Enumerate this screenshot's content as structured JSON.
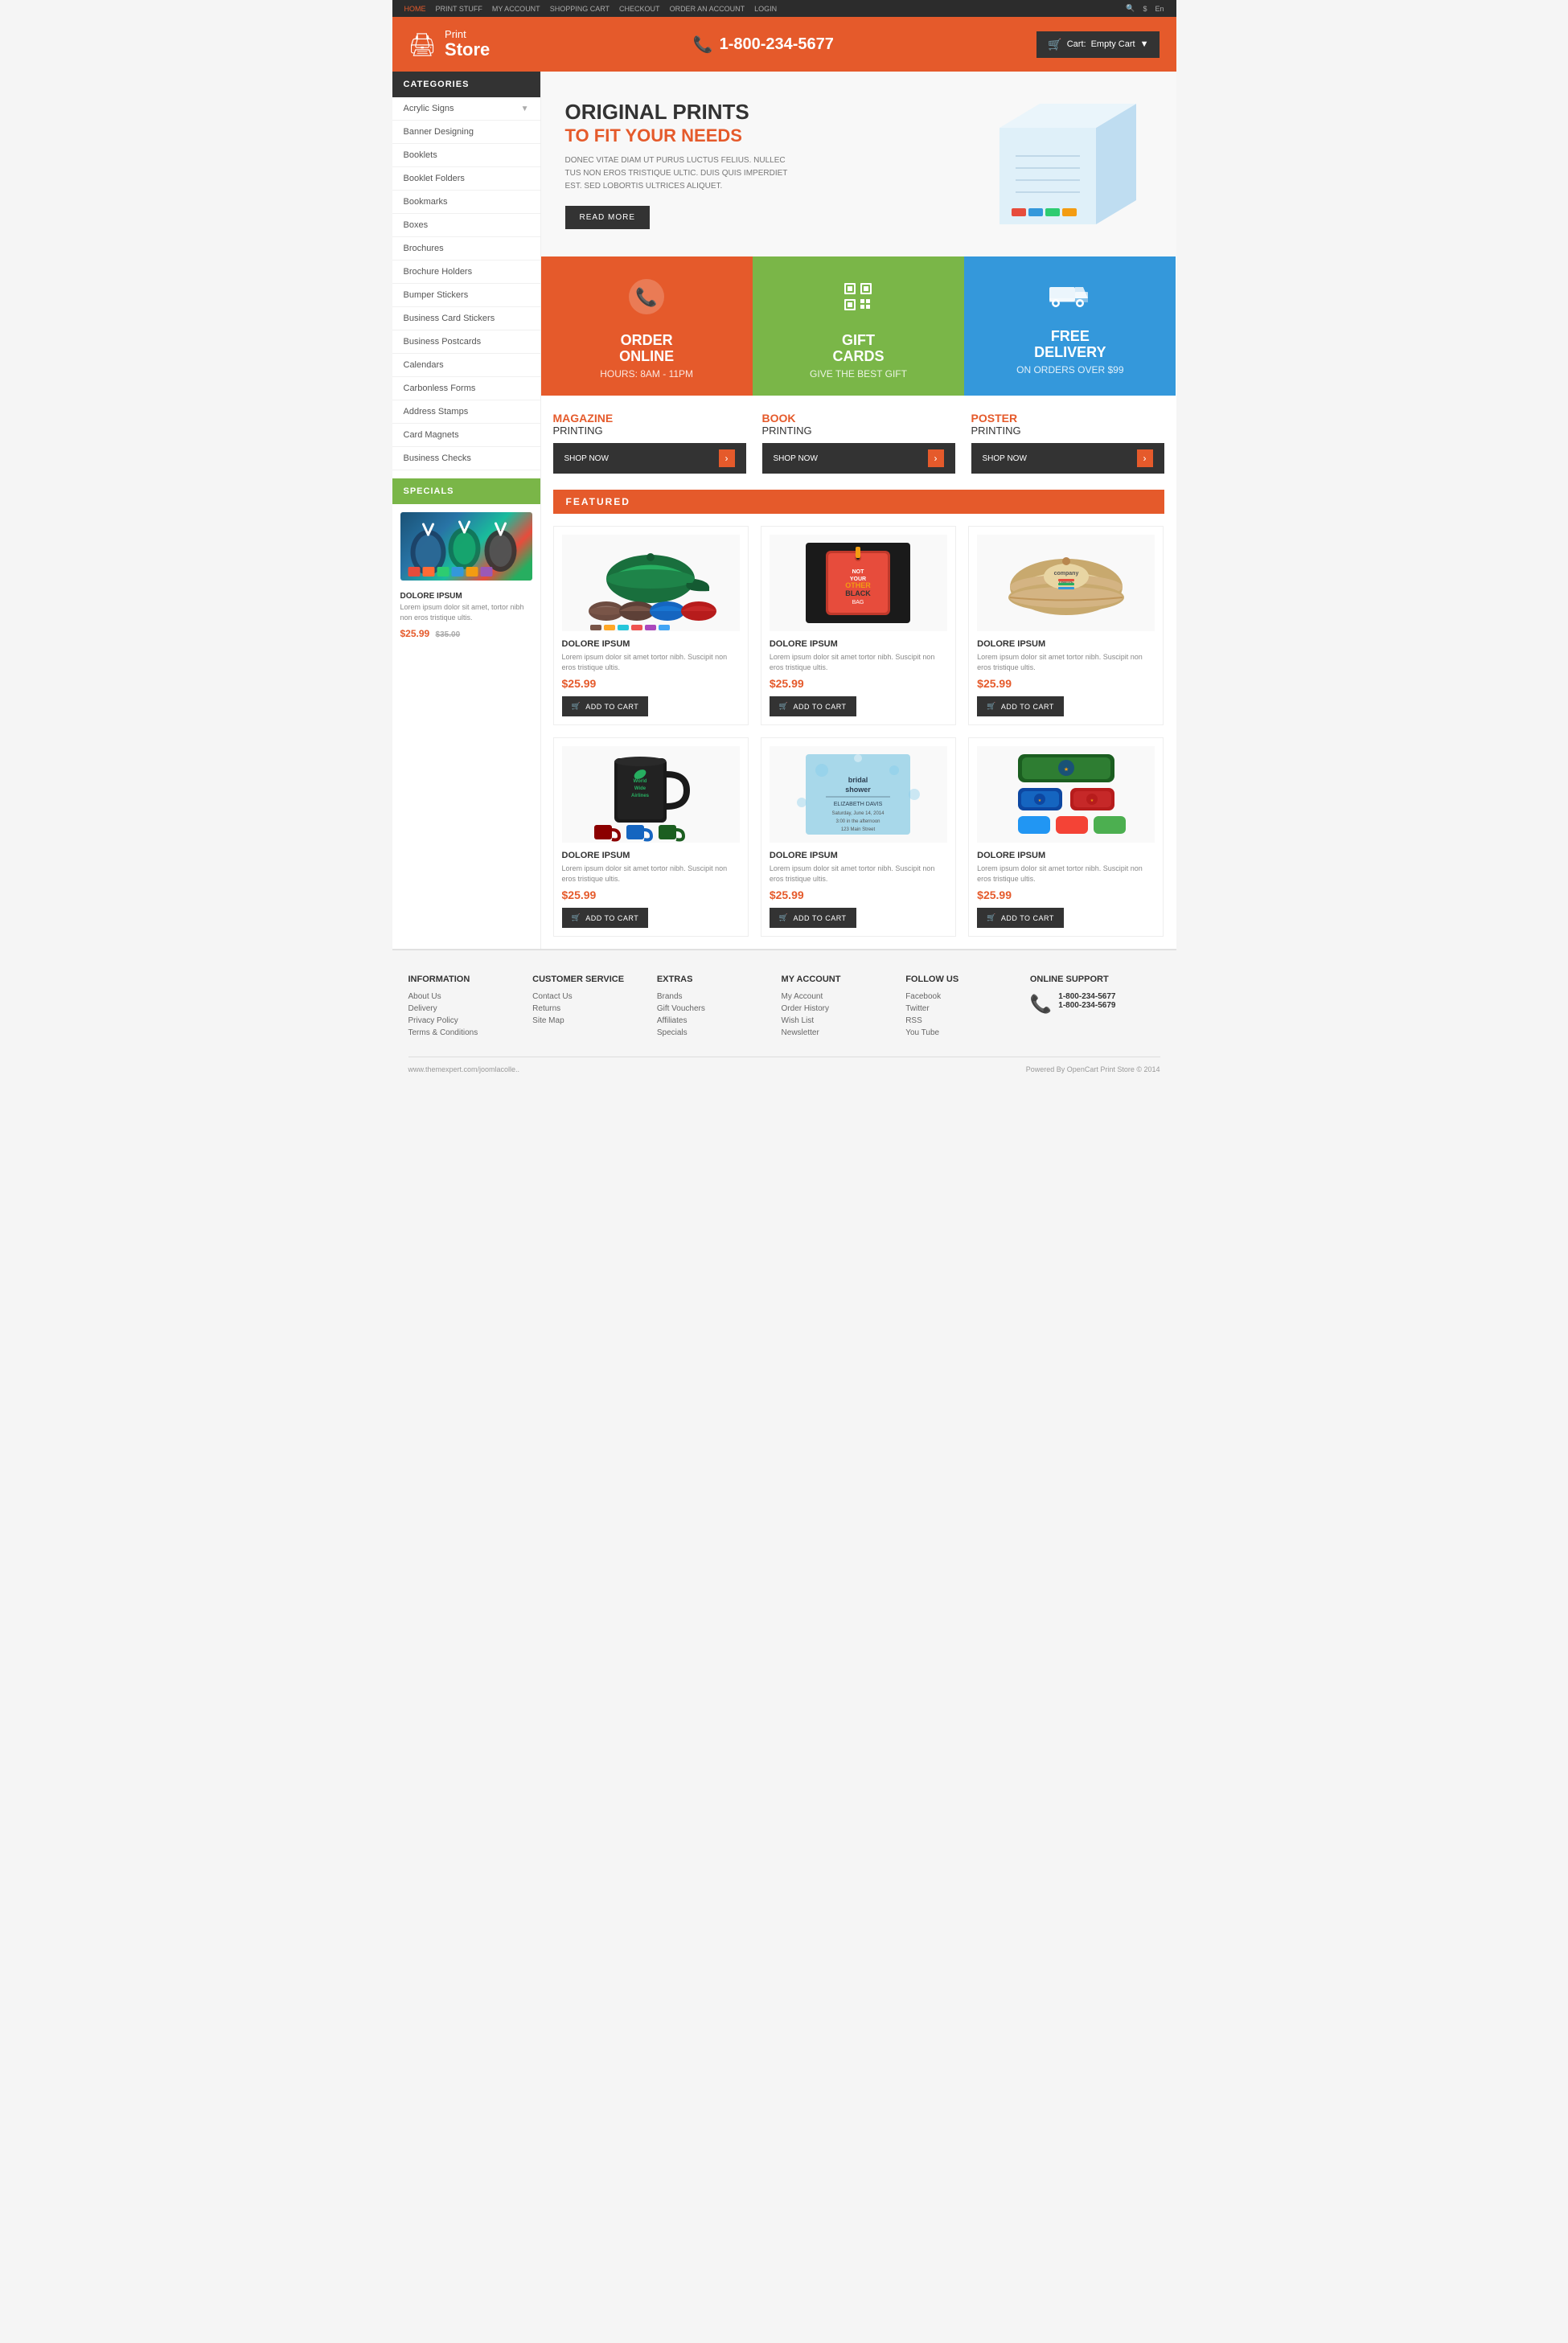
{
  "site": {
    "url": "www.themexpert.com/joomlacolle..",
    "powered_by": "Powered By OpenCart Print Store © 2014"
  },
  "top_nav": {
    "links": [
      "HOME",
      "PRINT STUFF",
      "MY ACCOUNT",
      "SHOPPING CART",
      "CHECKOUT",
      "ORDER AN ACCOUNT",
      "LOGIN"
    ],
    "active": "HOME",
    "search_placeholder": "Search...",
    "currency": "$",
    "language": "En"
  },
  "header": {
    "logo_print": "Print",
    "logo_store": "Store",
    "phone": "1-800-234-5677",
    "cart_label": "Cart:",
    "cart_items": "Empty Cart"
  },
  "sidebar": {
    "categories_label": "CATEGORIES",
    "items": [
      {
        "label": "Acrylic Signs",
        "has_dropdown": true
      },
      {
        "label": "Banner Designing",
        "has_dropdown": false
      },
      {
        "label": "Booklets",
        "has_dropdown": false
      },
      {
        "label": "Booklet Folders",
        "has_dropdown": false
      },
      {
        "label": "Bookmarks",
        "has_dropdown": false
      },
      {
        "label": "Boxes",
        "has_dropdown": false
      },
      {
        "label": "Brochures",
        "has_dropdown": false
      },
      {
        "label": "Brochure Holders",
        "has_dropdown": false
      },
      {
        "label": "Bumper Stickers",
        "has_dropdown": false
      },
      {
        "label": "Business Card Stickers",
        "has_dropdown": false
      },
      {
        "label": "Business Postcards",
        "has_dropdown": false
      },
      {
        "label": "Calendars",
        "has_dropdown": false
      },
      {
        "label": "Carbonless Forms",
        "has_dropdown": false
      },
      {
        "label": "Address Stamps",
        "has_dropdown": false
      },
      {
        "label": "Card Magnets",
        "has_dropdown": false
      },
      {
        "label": "Business Checks",
        "has_dropdown": false
      }
    ],
    "specials_label": "SPECIALS",
    "specials_product": {
      "name": "DOLORE IPSUM",
      "description": "Lorem ipsum dolor sit amet, tortor nibh non eros tristique ultis.",
      "price": "$25.99",
      "old_price": "$35.00"
    }
  },
  "hero": {
    "title": "ORIGINAL PRINTS",
    "subtitle": "TO FIT YOUR NEEDS",
    "description": "DONEC VITAE DIAM UT PURUS LUCTUS FELIUS. NULLEC TUS NON EROS TRISTIQUE ULTIC. DUIS QUIS IMPERDIET EST. SED LOBORTIS ULTRICES ALIQUET.",
    "cta_label": "READ MORE"
  },
  "feature_boxes": [
    {
      "icon": "📞",
      "title": "ORDER\nONLINE",
      "subtitle": "HOURS: 8AM - 11PM",
      "color": "orange"
    },
    {
      "icon": "qr",
      "title": "GIFT\nCARDS",
      "subtitle": "GIVE THE BEST GIFT",
      "color": "green"
    },
    {
      "icon": "🚚",
      "title": "FREE\nDELIVERY",
      "subtitle": "ON ORDERS OVER $99",
      "color": "blue"
    }
  ],
  "printing": [
    {
      "type": "MAGAZINE",
      "label": "PRINTING",
      "btn": "SHOP NOW"
    },
    {
      "type": "BOOK",
      "label": "PRINTING",
      "btn": "SHOP NOW"
    },
    {
      "type": "POSTER",
      "label": "PRINTING",
      "btn": "SHOP NOW"
    }
  ],
  "featured": {
    "label": "FEATURED",
    "products": [
      {
        "name": "DOLORE IPSUM",
        "description": "Lorem ipsum dolor sit amet tortor nibh. Suscipit non eros tristique ultis.",
        "price": "$25.99",
        "add_to_cart": "ADD TO CART",
        "img_type": "caps"
      },
      {
        "name": "DOLORE IPSUM",
        "description": "Lorem ipsum dolor sit amet tortor nibh. Suscipit non eros tristique ultis.",
        "price": "$25.99",
        "add_to_cart": "ADD TO CART",
        "img_type": "tags"
      },
      {
        "name": "DOLORE IPSUM",
        "description": "Lorem ipsum dolor sit amet tortor nibh. Suscipit non eros tristique ultis.",
        "price": "$25.99",
        "add_to_cart": "ADD TO CART",
        "img_type": "hats"
      },
      {
        "name": "DOLORE IPSUM",
        "description": "Lorem ipsum dolor sit amet tortor nibh. Suscipit non eros tristique ultis.",
        "price": "$25.99",
        "add_to_cart": "ADD TO CART",
        "img_type": "mugs"
      },
      {
        "name": "DOLORE IPSUM",
        "description": "Lorem ipsum dolor sit amet tortor nibh. Suscipit non eros tristique ultis.",
        "price": "$25.99",
        "add_to_cart": "ADD TO CART",
        "img_type": "cards"
      },
      {
        "name": "DOLORE IPSUM",
        "description": "Lorem ipsum dolor sit amet tortor nibh. Suscipit non eros tristique ultis.",
        "price": "$25.99",
        "add_to_cart": "ADD TO CART",
        "img_type": "bands"
      }
    ]
  },
  "footer": {
    "columns": [
      {
        "title": "INFORMATION",
        "links": [
          "About Us",
          "Delivery",
          "Privacy Policy",
          "Terms & Conditions"
        ]
      },
      {
        "title": "CUSTOMER SERVICE",
        "links": [
          "Contact Us",
          "Returns",
          "Site Map"
        ]
      },
      {
        "title": "EXTRAS",
        "links": [
          "Brands",
          "Gift Vouchers",
          "Affiliates",
          "Specials"
        ]
      },
      {
        "title": "MY ACCOUNT",
        "links": [
          "My Account",
          "Order History",
          "Wish List",
          "Newsletter"
        ]
      },
      {
        "title": "FOLLOW US",
        "links": [
          "Facebook",
          "Twitter",
          "RSS",
          "You Tube"
        ]
      },
      {
        "title": "ONLINE SUPPORT",
        "phone1": "1-800-234-5677",
        "phone2": "1-800-234-5679"
      }
    ],
    "url": "www.themexpert.com/joomlacolle..",
    "powered_by": "Powered By OpenCart Print Store © 2014"
  }
}
